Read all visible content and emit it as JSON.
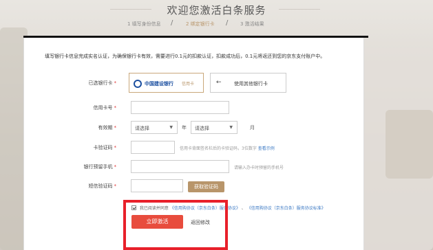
{
  "page": {
    "title": "欢迎您激活白条服务",
    "steps": [
      {
        "label": "1  填写身份信息",
        "active": false
      },
      {
        "label": "2  绑定银行卡",
        "active": true
      },
      {
        "label": "3  激活结果",
        "active": false
      }
    ],
    "step_separator": "/"
  },
  "form": {
    "notice": "填写银行卡信息完成实名认证，为确保银行卡有效，需要进行0.1元的扣款认证，扣款成功后，0.1元将返还到您的京东支付账户中。",
    "bank": {
      "label": "已选银行卡",
      "selected_name": "中国建设银行",
      "selected_tag": "信用卡",
      "other_arrow": "←",
      "other_label": "使用其他银行卡"
    },
    "card_number": {
      "label": "信用卡号",
      "value": ""
    },
    "expiry": {
      "label": "有效期",
      "month_placeholder": "请选择",
      "month_unit": "年",
      "year_placeholder": "请选择",
      "year_unit": "月"
    },
    "cvv": {
      "label": "卡验证码",
      "value": "",
      "hint": "信用卡背面签名栏后的卡验证码，3位数字",
      "hint_link": "查看示例"
    },
    "phone": {
      "label": "银行预留手机",
      "value": "",
      "hint": "请输入办卡时预留的手机号"
    },
    "sms": {
      "label": "短信验证码",
      "value": "",
      "button": "获取验证码"
    },
    "agreement": {
      "prefix": "我已阅读并同意",
      "link1": "《信用购协议（京东白条）服务协议》",
      "sep": "、",
      "link2": "《信用购协议（京东白条）服务协议标准》"
    },
    "submit_label": "立即激活",
    "back_label": "返回修改"
  },
  "colors": {
    "accent_gold": "#b8956a",
    "primary_red": "#e84c3d",
    "highlight_box": "#e8202a",
    "link_blue": "#3a78c3"
  }
}
